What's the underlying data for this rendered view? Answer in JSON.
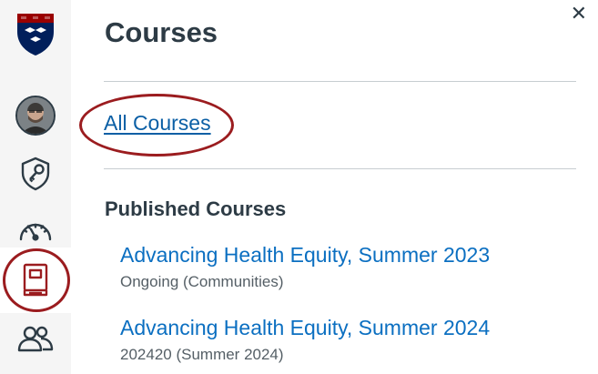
{
  "tray": {
    "title": "Courses",
    "all_courses_label": "All Courses",
    "published_heading": "Published Courses",
    "courses": [
      {
        "name": "Advancing Health Equity, Summer 2023",
        "term": "Ongoing (Communities)"
      },
      {
        "name": "Advancing Health Equity, Summer 2024",
        "term": "202420 (Summer 2024)"
      }
    ]
  },
  "close_glyph": "✕",
  "colors": {
    "brand_navy": "#011f5b",
    "brand_red": "#990000",
    "link": "#0b6fc1",
    "highlight": "#9b1c1f",
    "icon": "#2d3b45"
  },
  "icons": [
    "penn-shield-logo-icon",
    "account-avatar",
    "admin-key-shield-icon",
    "dashboard-gauge-icon",
    "courses-book-icon",
    "groups-people-icon",
    "close-icon"
  ]
}
